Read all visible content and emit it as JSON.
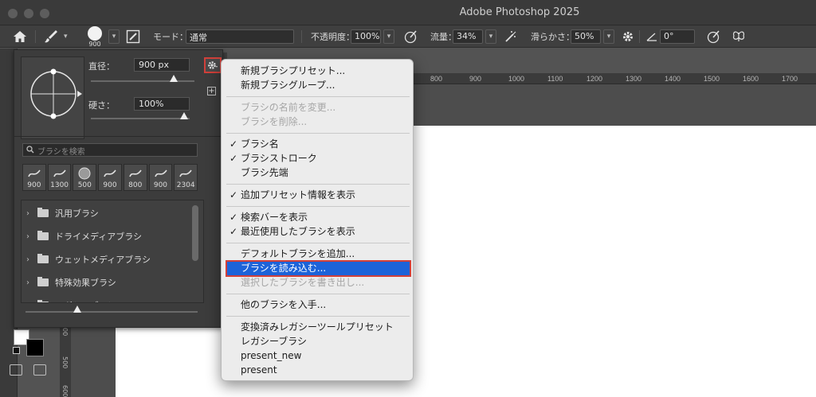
{
  "window": {
    "title": "Adobe Photoshop 2025"
  },
  "options_bar": {
    "brush_size": "900",
    "mode_label": "モード：",
    "mode_value": "通常",
    "opacity_label": "不透明度：",
    "opacity_value": "100%",
    "flow_label": "流量：",
    "flow_value": "34%",
    "smoothing_label": "滑らかさ：",
    "smoothing_value": "50%",
    "angle_value": "0°"
  },
  "brush_panel": {
    "diameter_label": "直径：",
    "diameter_value": "900 px",
    "hardness_label": "硬さ：",
    "hardness_value": "100%",
    "diameter_fraction": 0.8,
    "hardness_fraction": 1.0,
    "search_placeholder": "ブラシを検索",
    "recent_brushes": [
      "900",
      "1300",
      "500",
      "900",
      "800",
      "900",
      "2304"
    ],
    "folders": [
      "汎用ブラシ",
      "ドライメディアブラシ",
      "ウェットメディアブラシ",
      "特殊効果ブラシ",
      "レガシーブラシ"
    ]
  },
  "document": {
    "tab_label": "",
    "ruler_ticks": [
      "800",
      "900",
      "1000",
      "1100",
      "1200",
      "1300",
      "1400",
      "1500",
      "1600",
      "1700"
    ],
    "vertical_ruler": [
      "00",
      "500",
      "600"
    ]
  },
  "context_menu": {
    "highlight_color": "#1c63d9",
    "items": [
      {
        "label": "新規ブラシプリセット...",
        "checked": false,
        "disabled": false
      },
      {
        "label": "新規ブラシグループ...",
        "checked": false,
        "disabled": false
      },
      {
        "label": "ブラシの名前を変更...",
        "checked": false,
        "disabled": true
      },
      {
        "label": "ブラシを削除...",
        "checked": false,
        "disabled": true
      },
      {
        "label": "ブラシ名",
        "checked": true,
        "disabled": false
      },
      {
        "label": "ブラシストローク",
        "checked": true,
        "disabled": false
      },
      {
        "label": "ブラシ先端",
        "checked": false,
        "disabled": false
      },
      {
        "label": "追加プリセット情報を表示",
        "checked": true,
        "disabled": false
      },
      {
        "label": "検索バーを表示",
        "checked": true,
        "disabled": false
      },
      {
        "label": "最近使用したブラシを表示",
        "checked": true,
        "disabled": false
      },
      {
        "label": "デフォルトブラシを追加...",
        "checked": false,
        "disabled": false
      },
      {
        "label": "ブラシを読み込む...",
        "checked": false,
        "disabled": false,
        "highlighted": true
      },
      {
        "label": "選択したブラシを書き出し...",
        "checked": false,
        "disabled": true
      },
      {
        "label": "他のブラシを入手...",
        "checked": false,
        "disabled": false
      },
      {
        "label": "変換済みレガシーツールプリセット",
        "checked": false,
        "disabled": false
      },
      {
        "label": "レガシーブラシ",
        "checked": false,
        "disabled": false
      },
      {
        "label": "present_new",
        "checked": false,
        "disabled": false
      },
      {
        "label": "present",
        "checked": false,
        "disabled": false
      }
    ]
  }
}
